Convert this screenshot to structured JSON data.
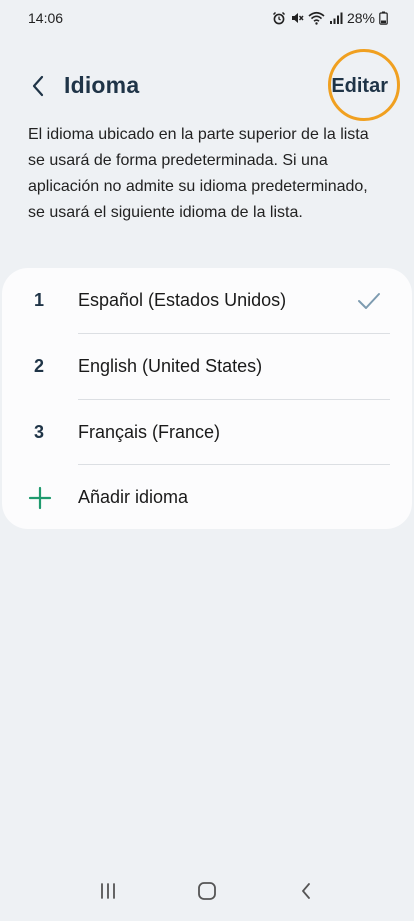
{
  "status_bar": {
    "time": "14:06",
    "battery": "28%",
    "icons": [
      "alarm-icon",
      "mute-icon",
      "wifi-icon",
      "signal-icon",
      "battery-icon"
    ]
  },
  "header": {
    "title": "Idioma",
    "edit_label": "Editar",
    "highlight_color": "#f0a020"
  },
  "description": "El idioma ubicado en la parte superior de la lista se usará de forma predeterminada. Si una aplicación no admite su idioma predeterminado, se usará el siguiente idioma de la lista.",
  "languages": [
    {
      "number": "1",
      "label": "Español (Estados Unidos)",
      "selected": true
    },
    {
      "number": "2",
      "label": "English (United States)",
      "selected": false
    },
    {
      "number": "3",
      "label": "Français (France)",
      "selected": false
    }
  ],
  "add_language": {
    "label": "Añadir idioma",
    "icon": "plus-icon",
    "color": "#1f9a6e"
  },
  "nav_bar": {
    "icons": [
      "recents-icon",
      "home-icon",
      "back-icon"
    ]
  },
  "colors": {
    "background": "#eef1f4",
    "card": "#fcfcfd",
    "title": "#1f3447",
    "check": "#7d9bb0"
  }
}
